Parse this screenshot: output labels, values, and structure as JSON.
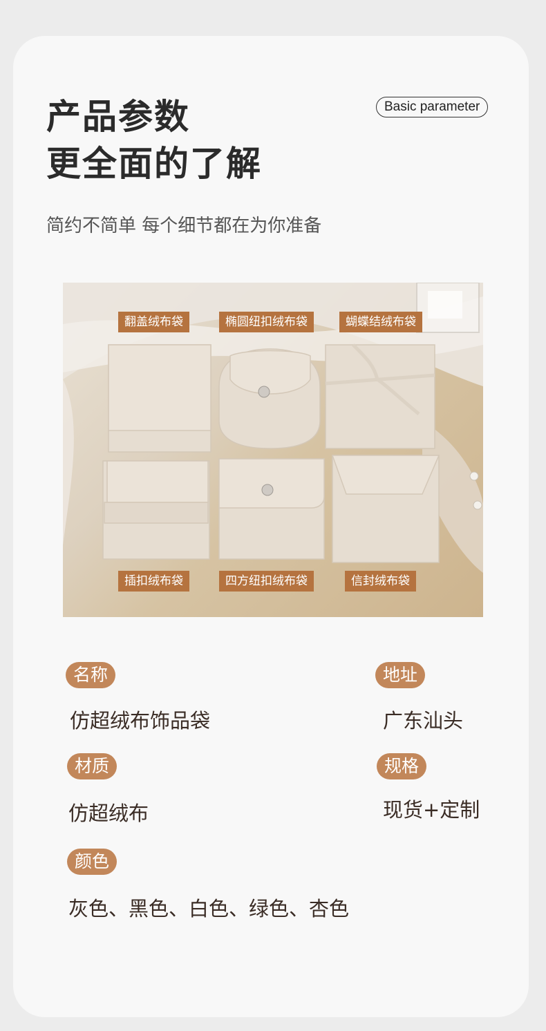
{
  "header": {
    "title_line1": "产品参数",
    "title_line2": "更全面的了解",
    "badge": "Basic parameter",
    "subtitle": "简约不简单 每个细节都在为你准备"
  },
  "photo": {
    "labels": [
      "翻盖绒布袋",
      "椭圆纽扣绒布袋",
      "蝴蝶结绒布袋",
      "插扣绒布袋",
      "四方纽扣绒布袋",
      "信封绒布袋"
    ]
  },
  "params": {
    "name_label": "名称",
    "name_value": "仿超绒布饰品袋",
    "address_label": "地址",
    "address_value": "广东汕头",
    "material_label": "材质",
    "material_value": "仿超绒布",
    "spec_label": "规格",
    "spec_value": "现货+定制",
    "color_label": "颜色",
    "color_value": "灰色、黑色、白色、绿色、杏色"
  },
  "colors": {
    "accent": "#c2875a",
    "tag_bg": "#b5733f",
    "pouch": "#e6ddd1"
  }
}
